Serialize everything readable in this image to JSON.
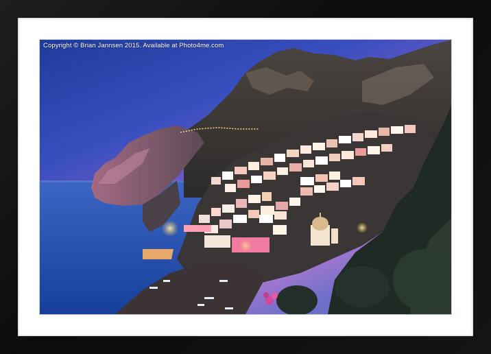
{
  "photo": {
    "copyright": "Copyright © Brian Jannsen 2015. Available at Photo4me.com"
  }
}
